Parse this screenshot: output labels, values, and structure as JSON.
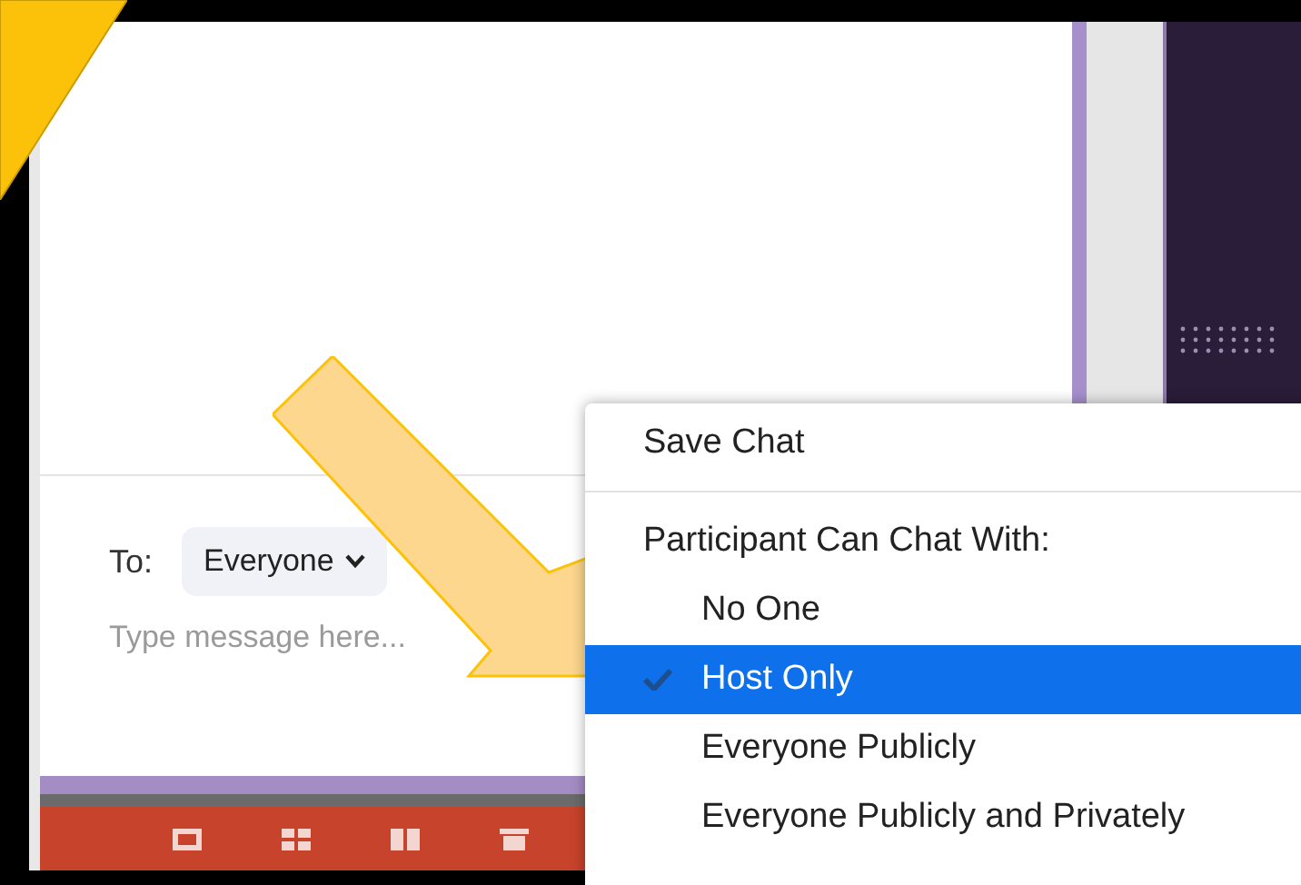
{
  "chat": {
    "to_label": "To:",
    "recipient": "Everyone",
    "placeholder": "Type message here..."
  },
  "menu": {
    "items": [
      {
        "kind": "action",
        "label": "Save Chat"
      },
      {
        "kind": "header",
        "label": "Participant Can Chat With:"
      },
      {
        "kind": "option",
        "label": "No One",
        "selected": false
      },
      {
        "kind": "option",
        "label": "Host Only",
        "selected": true
      },
      {
        "kind": "option",
        "label": "Everyone Publicly",
        "selected": false
      },
      {
        "kind": "option",
        "label": "Everyone Publicly and Privately",
        "selected": false
      }
    ]
  }
}
